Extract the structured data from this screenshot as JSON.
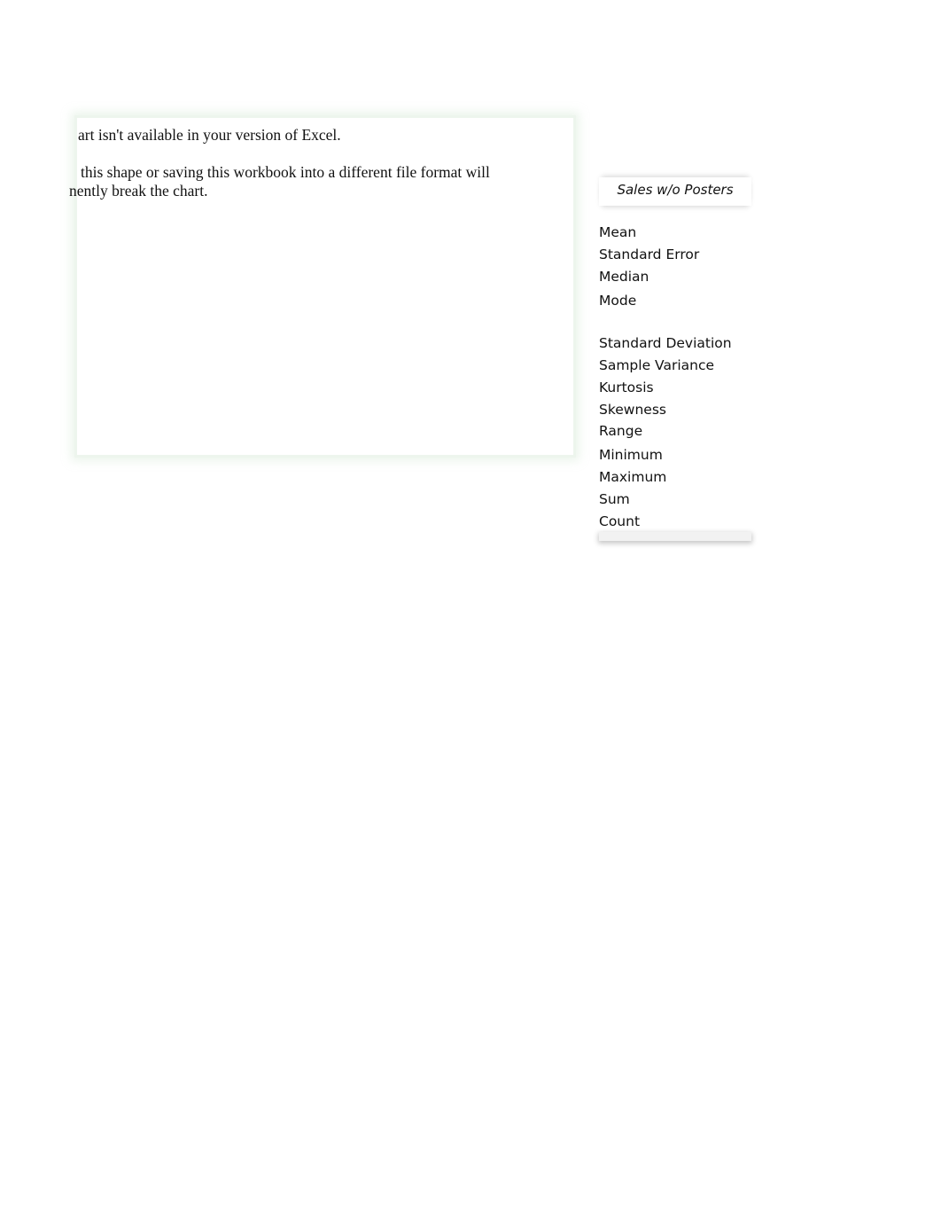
{
  "chart_placeholder": {
    "line1": "art isn't available in your version of Excel.",
    "line2": "this shape or saving this workbook into a different file format will",
    "line3": "nently break the chart."
  },
  "stats_table": {
    "header": "Sales w/o Posters",
    "rows": [
      "Mean",
      "Standard Error",
      "Median",
      "Mode",
      "Standard Deviation",
      "Sample Variance",
      "Kurtosis",
      "Skewness",
      "Range",
      "Minimum",
      "Maximum",
      "Sum",
      "Count"
    ]
  }
}
